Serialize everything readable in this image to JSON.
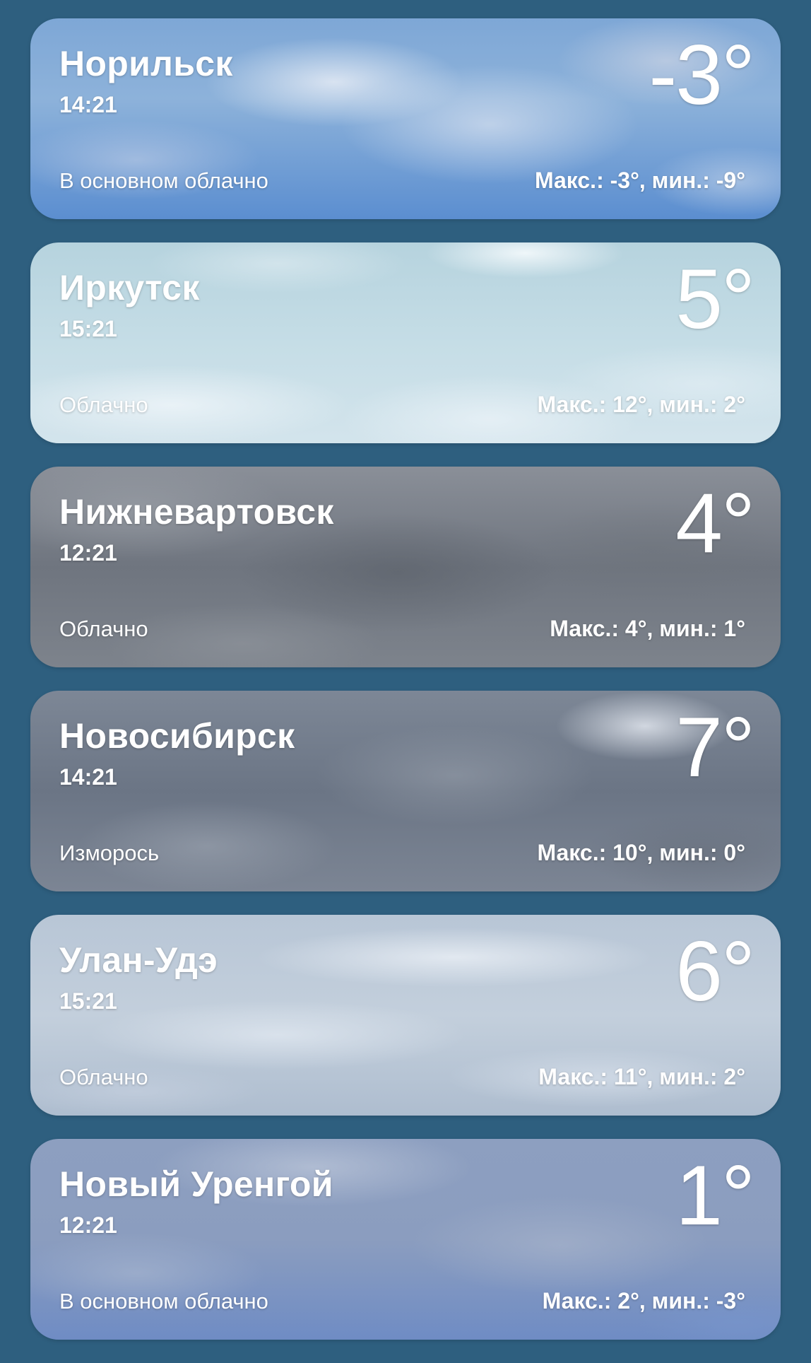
{
  "locations": [
    {
      "city": "Норильск",
      "time": "14:21",
      "temperature": "-3°",
      "condition": "В основном облачно",
      "hi_lo": "Макс.: -3°, мин.: -9°"
    },
    {
      "city": "Иркутск",
      "time": "15:21",
      "temperature": "5°",
      "condition": "Облачно",
      "hi_lo": "Макс.: 12°, мин.: 2°"
    },
    {
      "city": "Нижневартовск",
      "time": "12:21",
      "temperature": "4°",
      "condition": "Облачно",
      "hi_lo": "Макс.: 4°, мин.: 1°"
    },
    {
      "city": "Новосибирск",
      "time": "14:21",
      "temperature": "7°",
      "condition": "Изморось",
      "hi_lo": "Макс.: 10°, мин.: 0°"
    },
    {
      "city": "Улан-Удэ",
      "time": "15:21",
      "temperature": "6°",
      "condition": "Облачно",
      "hi_lo": "Макс.: 11°, мин.: 2°"
    },
    {
      "city": "Новый Уренгой",
      "time": "12:21",
      "temperature": "1°",
      "condition": "В основном облачно",
      "hi_lo": "Макс.: 2°, мин.: -3°"
    }
  ],
  "colors": {
    "page_background": "#2e5f7f",
    "text": "#ffffff"
  }
}
